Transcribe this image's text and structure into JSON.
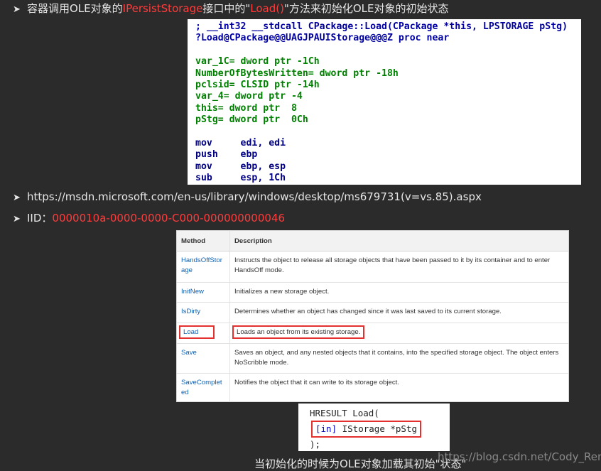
{
  "bullets": {
    "b1_prefix": "容器调用OLE对象的",
    "b1_red": "IPersistStorage",
    "b1_suffix1": "接口中的\"",
    "b1_red2": "Load()",
    "b1_suffix2": "\"方法来初始化OLE对象的初始状态",
    "b2": "https://msdn.microsoft.com/en-us/library/windows/desktop/ms679731(v=vs.85).aspx",
    "b3_prefix": "IID：",
    "b3_red": "0000010a-0000-0000-C000-000000000046"
  },
  "ida": {
    "lines": [
      "; __int32 __stdcall CPackage::Load(CPackage *this, LPSTORAGE pStg)",
      "?Load@CPackage@@UAGJPAUIStorage@@@Z proc near",
      "",
      "var_1C= dword ptr -1Ch",
      "NumberOfBytesWritten= dword ptr -18h",
      "pclsid= CLSID ptr -14h",
      "var_4= dword ptr -4",
      "this= dword ptr  8",
      "pStg= dword ptr  0Ch",
      "",
      "mov     edi, edi",
      "push    ebp",
      "mov     ebp, esp",
      "sub     esp, 1Ch"
    ]
  },
  "msdn": {
    "col_method": "Method",
    "col_desc": "Description",
    "rows": [
      {
        "method": "HandsOffStorage",
        "method_l1": "HandsOffStor",
        "method_l2": "age",
        "desc": "Instructs the object to release all storage objects that have been passed to it by its container and to enter HandsOff mode."
      },
      {
        "method": "InitNew",
        "method_l1": "InitNew",
        "method_l2": "",
        "desc": "Initializes a new storage object."
      },
      {
        "method": "IsDirty",
        "method_l1": "IsDirty",
        "method_l2": "",
        "desc": "Determines whether an object has changed since it was last saved to its current storage."
      },
      {
        "method": "Load",
        "method_l1": "Load",
        "method_l2": "",
        "desc": "Loads an object from its existing storage."
      },
      {
        "method": "Save",
        "method_l1": "Save",
        "method_l2": "",
        "desc": "Saves an object, and any nested objects that it contains, into the specified storage object. The object enters NoScribble mode."
      },
      {
        "method": "SaveCompleted",
        "method_l1": "SaveComplet",
        "method_l2": "ed",
        "desc": "Notifies the object that it can write to its storage object."
      }
    ]
  },
  "sig": {
    "line1": "HRESULT Load(",
    "in": "[in]",
    "param": " IStorage *pStg",
    "line3": ");"
  },
  "caption": "当初始化的时候为OLE对象加载其初始\"状态\"",
  "watermark": "https://blog.csdn.net/Cody_Ren"
}
